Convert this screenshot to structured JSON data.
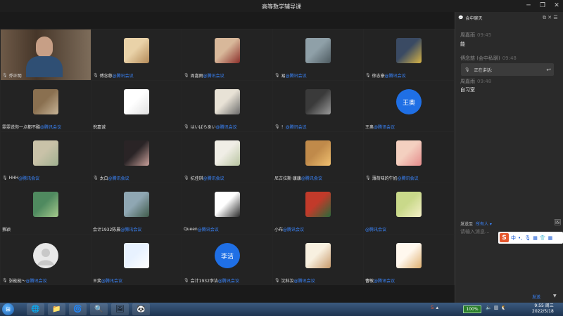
{
  "window": {
    "title": "高等数学辅导课",
    "controls": {
      "minimize": "─",
      "restore": "❐",
      "close": "✕"
    }
  },
  "tiles": [
    {
      "name": "乔正明",
      "suffix": "",
      "type": "video",
      "mic": true
    },
    {
      "name": "傅念慈",
      "suffix": "@腾讯会议",
      "type": "dog",
      "mic": true
    },
    {
      "name": "周嘉雨",
      "suffix": "@腾讯会议",
      "type": "cat",
      "mic": true
    },
    {
      "name": "易",
      "suffix": "@腾讯会议",
      "type": "street",
      "mic": true
    },
    {
      "name": "徐志豪",
      "suffix": "@腾讯会议",
      "type": "night",
      "mic": true
    },
    {
      "name": "雯雯说你一点都不酷",
      "suffix": "@腾讯会议",
      "type": "portrait",
      "mic": false
    },
    {
      "name": "倪嘉诚",
      "suffix": "",
      "type": "sketch",
      "mic": false
    },
    {
      "name": "はいばらあい",
      "suffix": "@腾讯会议",
      "type": "engraving",
      "mic": true
    },
    {
      "name": "！",
      "suffix": "@腾讯会议",
      "type": "bw",
      "mic": true
    },
    {
      "name": "王奥",
      "suffix": "@腾讯会议",
      "type": "textblue",
      "avatar_text": "王奥",
      "mic": false
    },
    {
      "name": "HHH",
      "suffix": "@腾讯会议",
      "type": "lying",
      "mic": true
    },
    {
      "name": "太白",
      "suffix": "@腾讯会议",
      "type": "anime",
      "mic": true
    },
    {
      "name": "杭佳琪",
      "suffix": "@腾讯会议",
      "type": "flowers",
      "mic": true
    },
    {
      "name": "尼古拉斯·康康",
      "suffix": "@腾讯会议",
      "type": "lion",
      "mic": false
    },
    {
      "name": "薄荷味的牛奶",
      "suffix": "@腾讯会议",
      "type": "baby",
      "mic": true
    },
    {
      "name": "蔡颖",
      "suffix": "",
      "type": "green",
      "mic": false
    },
    {
      "name": "会计1932陈晨",
      "suffix": "@腾讯会议",
      "type": "landscape",
      "mic": false
    },
    {
      "name": "Queen",
      "suffix": "@腾讯会议",
      "type": "cartoon",
      "mic": false
    },
    {
      "name": "小布",
      "suffix": "@腾讯会议",
      "type": "football",
      "mic": false
    },
    {
      "name": "",
      "suffix": "@腾讯会议",
      "type": "daisy",
      "mic": false
    },
    {
      "name": "张能能～",
      "suffix": "@腾讯会议",
      "type": "default",
      "mic": true
    },
    {
      "name": "王笑",
      "suffix": "@腾讯会议",
      "type": "bunny",
      "mic": false
    },
    {
      "name": "会计1932李洁",
      "suffix": "@腾讯会议",
      "type": "textblue",
      "avatar_text": "李洁",
      "mic": true
    },
    {
      "name": "沈科汝",
      "suffix": "@腾讯会议",
      "type": "bird",
      "mic": true
    },
    {
      "name": "曹敏",
      "suffix": "@腾讯会议",
      "type": "floral",
      "mic": false
    }
  ],
  "chat": {
    "title": "会中聊天",
    "header_icons": "⧉ ✕ ☰",
    "messages": [
      {
        "sender": "周嘉雨",
        "time": "09:45",
        "text": "能"
      },
      {
        "sender": "傅念慈",
        "tag": "(会中私聊)",
        "time": "09:48"
      },
      {
        "sender": "周嘉雨",
        "time": "09:48",
        "text": "自习室"
      }
    ],
    "speaking_label": "正在讲话:",
    "send_to_label": "发送至",
    "send_to_target": "所有人 ▾",
    "input_placeholder": "请输入消息...",
    "send_button": "发送",
    "send_arrow": "▼"
  },
  "ime": {
    "logo": "S",
    "items": [
      "中",
      "•,",
      "🎙",
      "▦",
      "👕",
      "▦"
    ]
  },
  "taskbar": {
    "start_glyph": "⊞",
    "apps": [
      "🌐",
      "📁",
      "🌀",
      "🔍",
      "🖼",
      "🐼"
    ],
    "battery": "100%",
    "clock_time": "9:55 周三",
    "clock_date": "2022/5/18"
  },
  "colors": {
    "accent": "#3a86ff",
    "avatar_blue": "#1f6fe5",
    "panel_bg": "#2a2a2a",
    "grid_bg": "#262626"
  }
}
